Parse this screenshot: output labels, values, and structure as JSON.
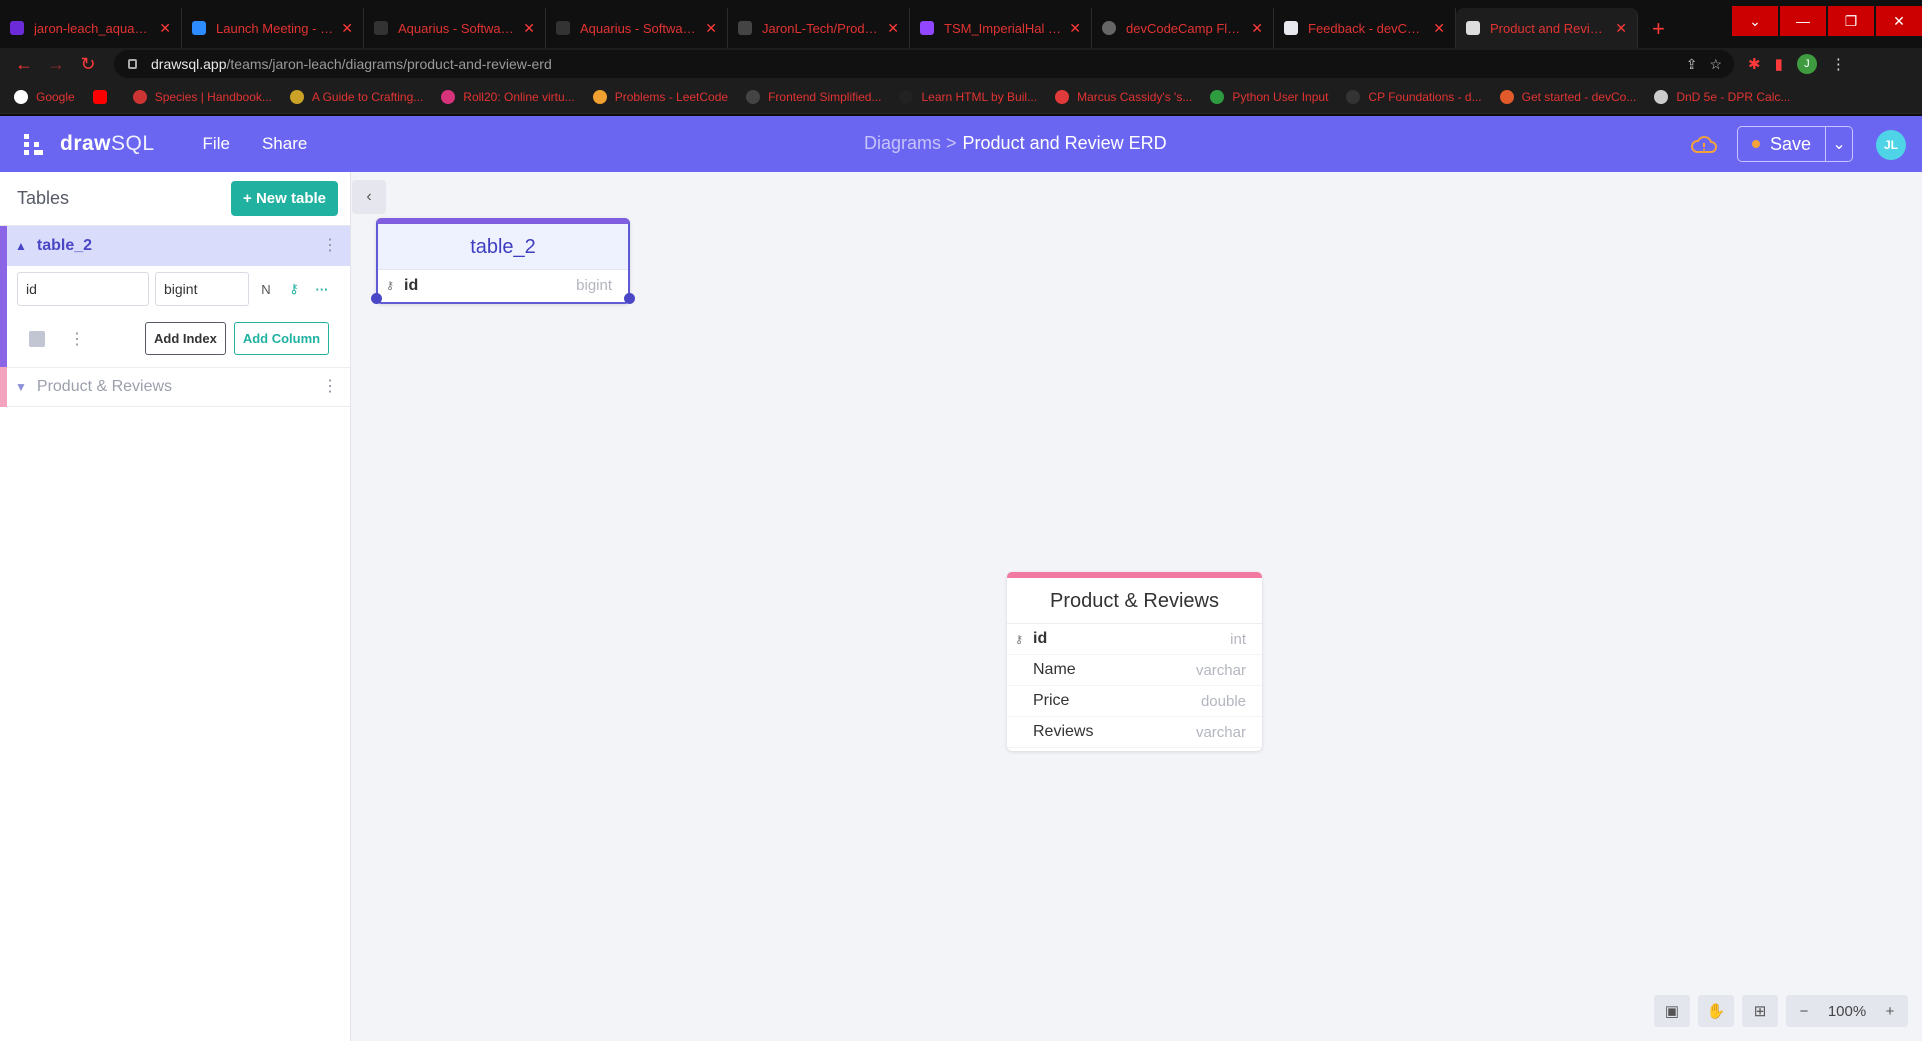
{
  "browser": {
    "tabs": [
      {
        "title": "jaron-leach_aquarius"
      },
      {
        "title": "Launch Meeting - Zoom"
      },
      {
        "title": "Aquarius - Software D"
      },
      {
        "title": "Aquarius - Software D"
      },
      {
        "title": "JaronL-Tech/Product-"
      },
      {
        "title": "TSM_ImperialHal - Tw"
      },
      {
        "title": "devCodeCamp FlexBo"
      },
      {
        "title": "Feedback - devCodeC"
      },
      {
        "title": "Product and Review E"
      }
    ],
    "url_host": "drawsql.app",
    "url_path": "/teams/jaron-leach/diagrams/product-and-review-erd",
    "profile_initial": "J",
    "bookmarks": [
      "Google",
      "",
      "Species | Handbook...",
      "A Guide to Crafting...",
      "Roll20: Online virtu...",
      "Problems - LeetCode",
      "Frontend Simplified...",
      "Learn HTML by Buil...",
      "Marcus Cassidy's 's...",
      "Python User Input",
      "CP Foundations - d...",
      "Get started - devCo...",
      "DnD 5e - DPR Calc..."
    ]
  },
  "app": {
    "logo_bold": "draw",
    "logo_light": "SQL",
    "menu": {
      "file": "File",
      "share": "Share"
    },
    "breadcrumb_parent": "Diagrams >",
    "breadcrumb_current": "Product and Review ERD",
    "save_label": "Save",
    "avatar_initials": "JL",
    "colors": {
      "primary": "#6b66f2",
      "teal": "#21b1a0",
      "pink": "#f27aa0",
      "purple": "#8a66e6"
    }
  },
  "sidebar": {
    "title": "Tables",
    "new_table_label": "+ New table",
    "table_2": {
      "name": "table_2",
      "column_name": "id",
      "column_type": "bigint",
      "nullable_label": "N",
      "add_index_label": "Add Index",
      "add_column_label": "Add Column"
    },
    "product_reviews": {
      "name": "Product & Reviews"
    }
  },
  "canvas": {
    "table_a": {
      "title": "table_2",
      "rows": [
        {
          "name": "id",
          "type": "bigint"
        }
      ]
    },
    "table_b": {
      "title": "Product & Reviews",
      "rows": [
        {
          "name": "id",
          "type": "int"
        },
        {
          "name": "Name",
          "type": "varchar"
        },
        {
          "name": "Price",
          "type": "double"
        },
        {
          "name": "Reviews",
          "type": "varchar"
        }
      ]
    },
    "zoom": "100%"
  }
}
